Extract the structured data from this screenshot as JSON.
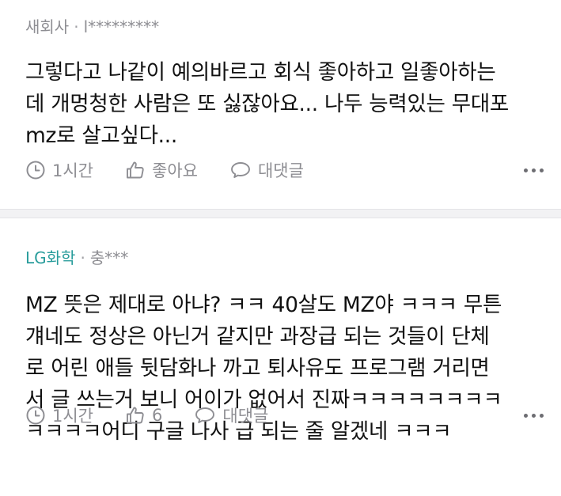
{
  "comments": [
    {
      "company": "새회사",
      "user": "l*********",
      "lines": [
        "그렇다고 나같이 예의바르고 회식 좋아하고 일좋아하는",
        "데 개멍청한 사람은 또 싫잖아요... 나두 능력있는 무대포",
        "mz로 살고싶다..."
      ],
      "time": "1시간",
      "like_label": "좋아요",
      "reply_label": "대댓글"
    },
    {
      "company": "LG화학",
      "user": "충***",
      "lines": [
        "MZ 뜻은 제대로 아냐? ㅋㅋ 40살도 MZ야 ㅋㅋㅋ 무튼",
        "걔네도 정상은 아닌거 같지만 과장급 되는 것들이 단체",
        "로 어린 애들 뒷담화나 까고 퇴사유도 프로그램 거리면",
        "서 글 쓰는거 보니 어이가 없어서 진짜ㅋㅋㅋㅋㅋㅋㅋㅋ",
        "ㅋㅋㅋㅋ어디 구글 나사 급 되는 줄 알겠네 ㅋㅋㅋ"
      ],
      "time": "1시간",
      "like_label": "6",
      "reply_label": "대댓글"
    }
  ],
  "meta_separator": "·",
  "colors": {
    "company_link": "#2a9d9c",
    "meta_gray": "#8e8e93",
    "divider": "#f2f2f4"
  },
  "icons": [
    "clock-icon",
    "thumbs-up-icon",
    "speech-bubble-icon",
    "more-options-icon"
  ]
}
